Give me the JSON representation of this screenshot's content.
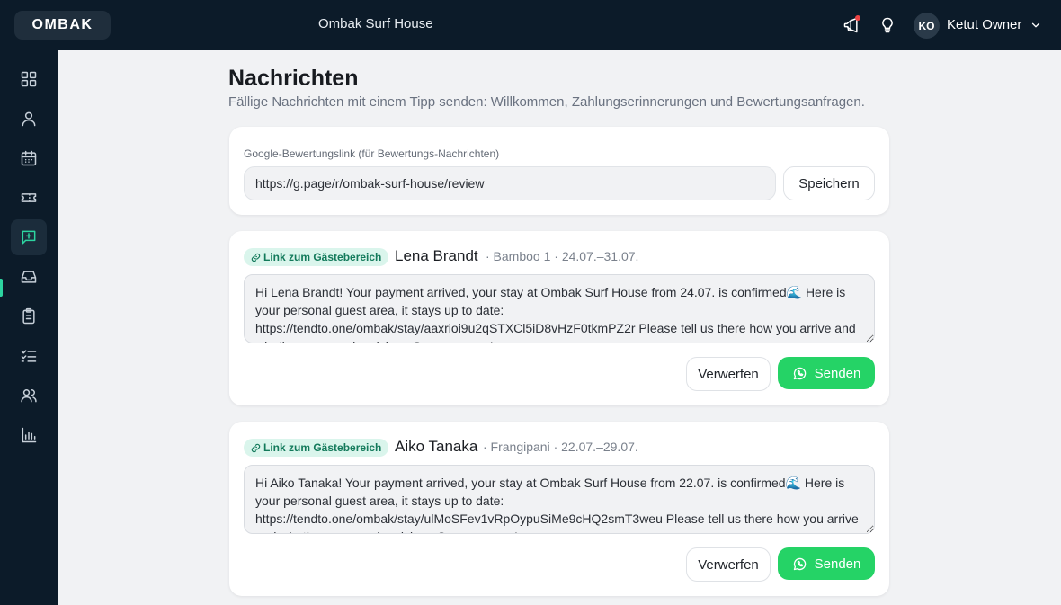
{
  "app": {
    "brand": "OMBAK",
    "property_name": "Ombak Surf House"
  },
  "user": {
    "initials": "KO",
    "name": "Ketut Owner"
  },
  "icons": {
    "announce": "megaphone-icon",
    "tip": "lightbulb-icon",
    "user_menu": "chevron-down-icon",
    "nav": [
      "dashboard-icon",
      "user-icon",
      "calendar-icon",
      "ticket-icon",
      "messages-icon",
      "inbox-icon",
      "clipboard-icon",
      "checklist-icon",
      "users-icon",
      "bar-chart-icon"
    ]
  },
  "colors": {
    "accent": "#2dd4a0",
    "whatsapp": "#25d366",
    "sidebar": "#0c1b29",
    "notification": "#ef4444"
  },
  "page": {
    "title": "Nachrichten",
    "subtitle": "Fällige Nachrichten mit einem Tipp senden: Willkommen, Zahlungserinnerungen und Bewertungsanfragen."
  },
  "review": {
    "label": "Google-Bewertungslink (für Bewertungs-Nachrichten)",
    "value": "https://g.page/r/ombak-surf-house/review",
    "save_label": "Speichern"
  },
  "messages": [
    {
      "chip": "Link zum Gästebereich",
      "guest": "Lena Brandt",
      "meta": "· Bamboo 1 · 24.07.–31.07.",
      "text": "Hi Lena Brandt! Your payment arrived, your stay at Ombak Surf House from 24.07. is confirmed🌊 Here is your personal guest area, it stays up to date: https://tendto.one/ombak/stay/aaxrioi9u2qSTXCl5iD8vHzF0tkmPZ2r Please tell us there how you arrive and whether you need a pickup. See you soon!",
      "discard_label": "Verwerfen",
      "send_label": "Senden"
    },
    {
      "chip": "Link zum Gästebereich",
      "guest": "Aiko Tanaka",
      "meta": "· Frangipani · 22.07.–29.07.",
      "text": "Hi Aiko Tanaka! Your payment arrived, your stay at Ombak Surf House from 22.07. is confirmed🌊 Here is your personal guest area, it stays up to date: https://tendto.one/ombak/stay/ulMoSFev1vRpOypuSiMe9cHQ2smT3weu Please tell us there how you arrive and whether you need a pickup. See you soon!",
      "discard_label": "Verwerfen",
      "send_label": "Senden"
    }
  ]
}
